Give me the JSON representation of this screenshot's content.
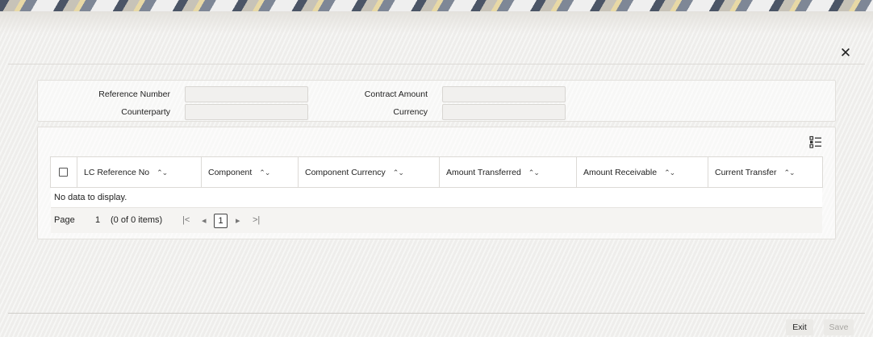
{
  "window": {
    "close_glyph": "✕"
  },
  "header": {
    "reference_number_label": "Reference Number",
    "reference_number_value": "",
    "counterparty_label": "Counterparty",
    "counterparty_value": "",
    "contract_amount_label": "Contract Amount",
    "contract_amount_value": "",
    "currency_label": "Currency",
    "currency_value": ""
  },
  "grid": {
    "columns": [
      "LC Reference No",
      "Component",
      "Component Currency",
      "Amount Transferred",
      "Amount Receivable",
      "Current Transfer"
    ],
    "sort_glyph": "⌃⌄",
    "empty_message": "No data to display.",
    "rows": []
  },
  "pager": {
    "page_label": "Page",
    "page_number": "1",
    "items_info": "(0 of 0 items)",
    "first_glyph": "|<",
    "prev_glyph": "◂",
    "current_page": "1",
    "next_glyph": "▸",
    "last_glyph": ">|"
  },
  "footer": {
    "exit_label": "Exit",
    "save_label": "Save"
  },
  "icons": {
    "close": "close-icon",
    "column_list": "list-view-icon",
    "sort": "sort-icon"
  }
}
